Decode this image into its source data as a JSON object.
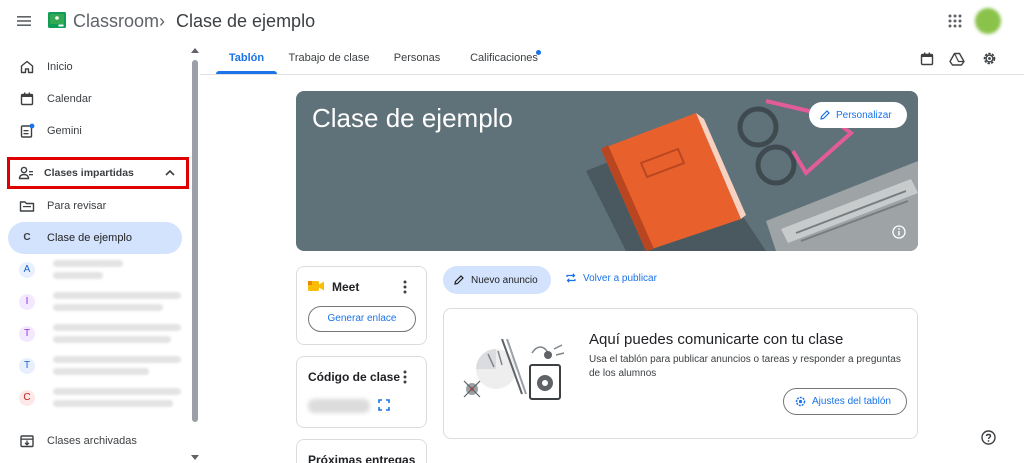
{
  "app": {
    "name": "Classroom",
    "breadcrumb_sep": "›",
    "class_title": "Clase de ejemplo"
  },
  "sidebar": {
    "inicio": "Inicio",
    "calendar": "Calendar",
    "gemini": "Gemini",
    "teaching_section": "Clases impartidas",
    "to_review": "Para revisar",
    "active_class_letter": "C",
    "active_class": "Clase de ejemplo",
    "classes": [
      {
        "letter": "A",
        "color": "#e8f0fe",
        "text_color": "#1967d2"
      },
      {
        "letter": "I",
        "color": "#f3e8fd",
        "text_color": "#9334e6"
      },
      {
        "letter": "T",
        "color": "#f3e8fd",
        "text_color": "#9334e6"
      },
      {
        "letter": "T",
        "color": "#e8f0fe",
        "text_color": "#1967d2"
      },
      {
        "letter": "C",
        "color": "#fce8e6",
        "text_color": "#c5221f"
      }
    ],
    "archived": "Clases archivadas"
  },
  "tabs": [
    "Tablón",
    "Trabajo de clase",
    "Personas",
    "Calificaciones"
  ],
  "banner": {
    "title": "Clase de ejemplo",
    "customize_label": "Personalizar"
  },
  "meet": {
    "title": "Meet",
    "generate_link": "Generar enlace"
  },
  "class_code": {
    "title": "Código de clase"
  },
  "upcoming": {
    "title": "Próximas entregas"
  },
  "stream": {
    "new_announcement": "Nuevo anuncio",
    "repost": "Volver a publicar",
    "heading": "Aquí puedes comunicarte con tu clase",
    "description": "Usa el tablón para publicar anuncios o tareas y responder a preguntas de los alumnos",
    "settings_button": "Ajustes del tablón"
  },
  "colors": {
    "accent": "#1a73e8",
    "highlight_box": "#e00000",
    "banner_bg": "#5f7179",
    "active_nav": "#d3e3fd"
  }
}
